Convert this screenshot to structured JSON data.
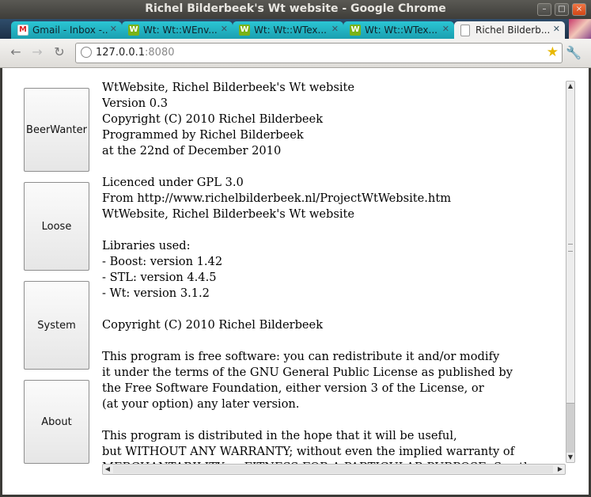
{
  "window": {
    "title": "Richel Bilderbeek's Wt website - Google Chrome",
    "minimize": "–",
    "maximize": "□",
    "close": "×"
  },
  "tabs": [
    {
      "label": "Gmail - Inbox -...",
      "favicon": "gmail-icon",
      "active": false
    },
    {
      "label": "Wt: Wt::WEnv...",
      "favicon": "wt-icon",
      "active": false
    },
    {
      "label": "Wt: Wt::WTex...",
      "favicon": "wt-icon",
      "active": false
    },
    {
      "label": "Wt: Wt::WTex...",
      "favicon": "wt-icon",
      "active": false
    },
    {
      "label": "Richel Bilderb...",
      "favicon": "page-icon",
      "active": true
    }
  ],
  "toolbar": {
    "back": "←",
    "forward": "→",
    "reload": "↻",
    "url_host": "127.0.0.1",
    "url_port": ":8080",
    "bookmark_star": "★",
    "wrench": "🔧"
  },
  "menu": [
    {
      "label": "BeerWanter"
    },
    {
      "label": "Loose"
    },
    {
      "label": "System"
    },
    {
      "label": "About"
    }
  ],
  "about_text": [
    "WtWebsite, Richel Bilderbeek's Wt website",
    "Version 0.3",
    "Copyright (C) 2010 Richel Bilderbeek",
    "Programmed by Richel Bilderbeek",
    "at the 22nd of December 2010",
    "",
    "Licenced under GPL 3.0",
    "From http://www.richelbilderbeek.nl/ProjectWtWebsite.htm",
    "WtWebsite, Richel Bilderbeek's Wt website",
    "",
    "Libraries used:",
    "- Boost: version 1.42",
    "- STL: version 4.4.5",
    "- Wt: version 3.1.2",
    "",
    "Copyright (C) 2010 Richel Bilderbeek",
    "",
    "This program is free software: you can redistribute it and/or modify",
    "it under the terms of the GNU General Public License as published by",
    "the Free Software Foundation, either version 3 of the License, or",
    "(at your option) any later version.",
    "",
    "This program is distributed in the hope that it will be useful,",
    "but WITHOUT ANY WARRANTY; without even the implied warranty of",
    "MERCHANTABILITY or FITNESS FOR A PARTICULAR PURPOSE. See the"
  ]
}
